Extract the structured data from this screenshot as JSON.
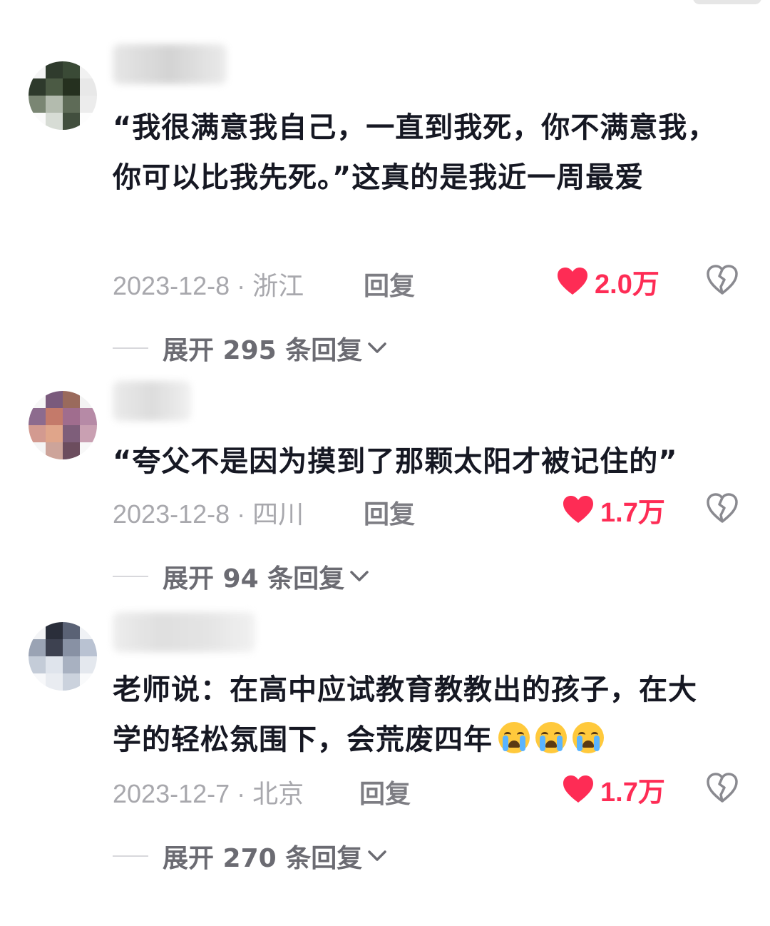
{
  "comments": [
    {
      "text": "“我很满意我自己，一直到我死，你不满意我，你可以比我先死。”这真的是我近一周最爱",
      "date_location": "2023-12-8 · 浙江",
      "reply_label": "回复",
      "likes": "2.0万",
      "expand_label": "展开 295 条回复",
      "emojis": []
    },
    {
      "text": "“夸父不是因为摸到了那颗太阳才被记住的”",
      "date_location": "2023-12-8 · 四川",
      "reply_label": "回复",
      "likes": "1.7万",
      "expand_label": "展开 94 条回复",
      "emojis": []
    },
    {
      "text": "老师说：在高中应试教育教教出的孩子，在大学的轻松氛围下，会荒废四年",
      "date_location": "2023-12-7 · 北京",
      "reply_label": "回复",
      "likes": "1.7万",
      "expand_label": "展开 270 条回复",
      "emojis": [
        "loudly-crying-face",
        "loudly-crying-face",
        "loudly-crying-face"
      ]
    }
  ],
  "colors": {
    "like_red": "#fe2c55",
    "meta_gray": "#a8a8ad",
    "text_dark": "#161823"
  }
}
